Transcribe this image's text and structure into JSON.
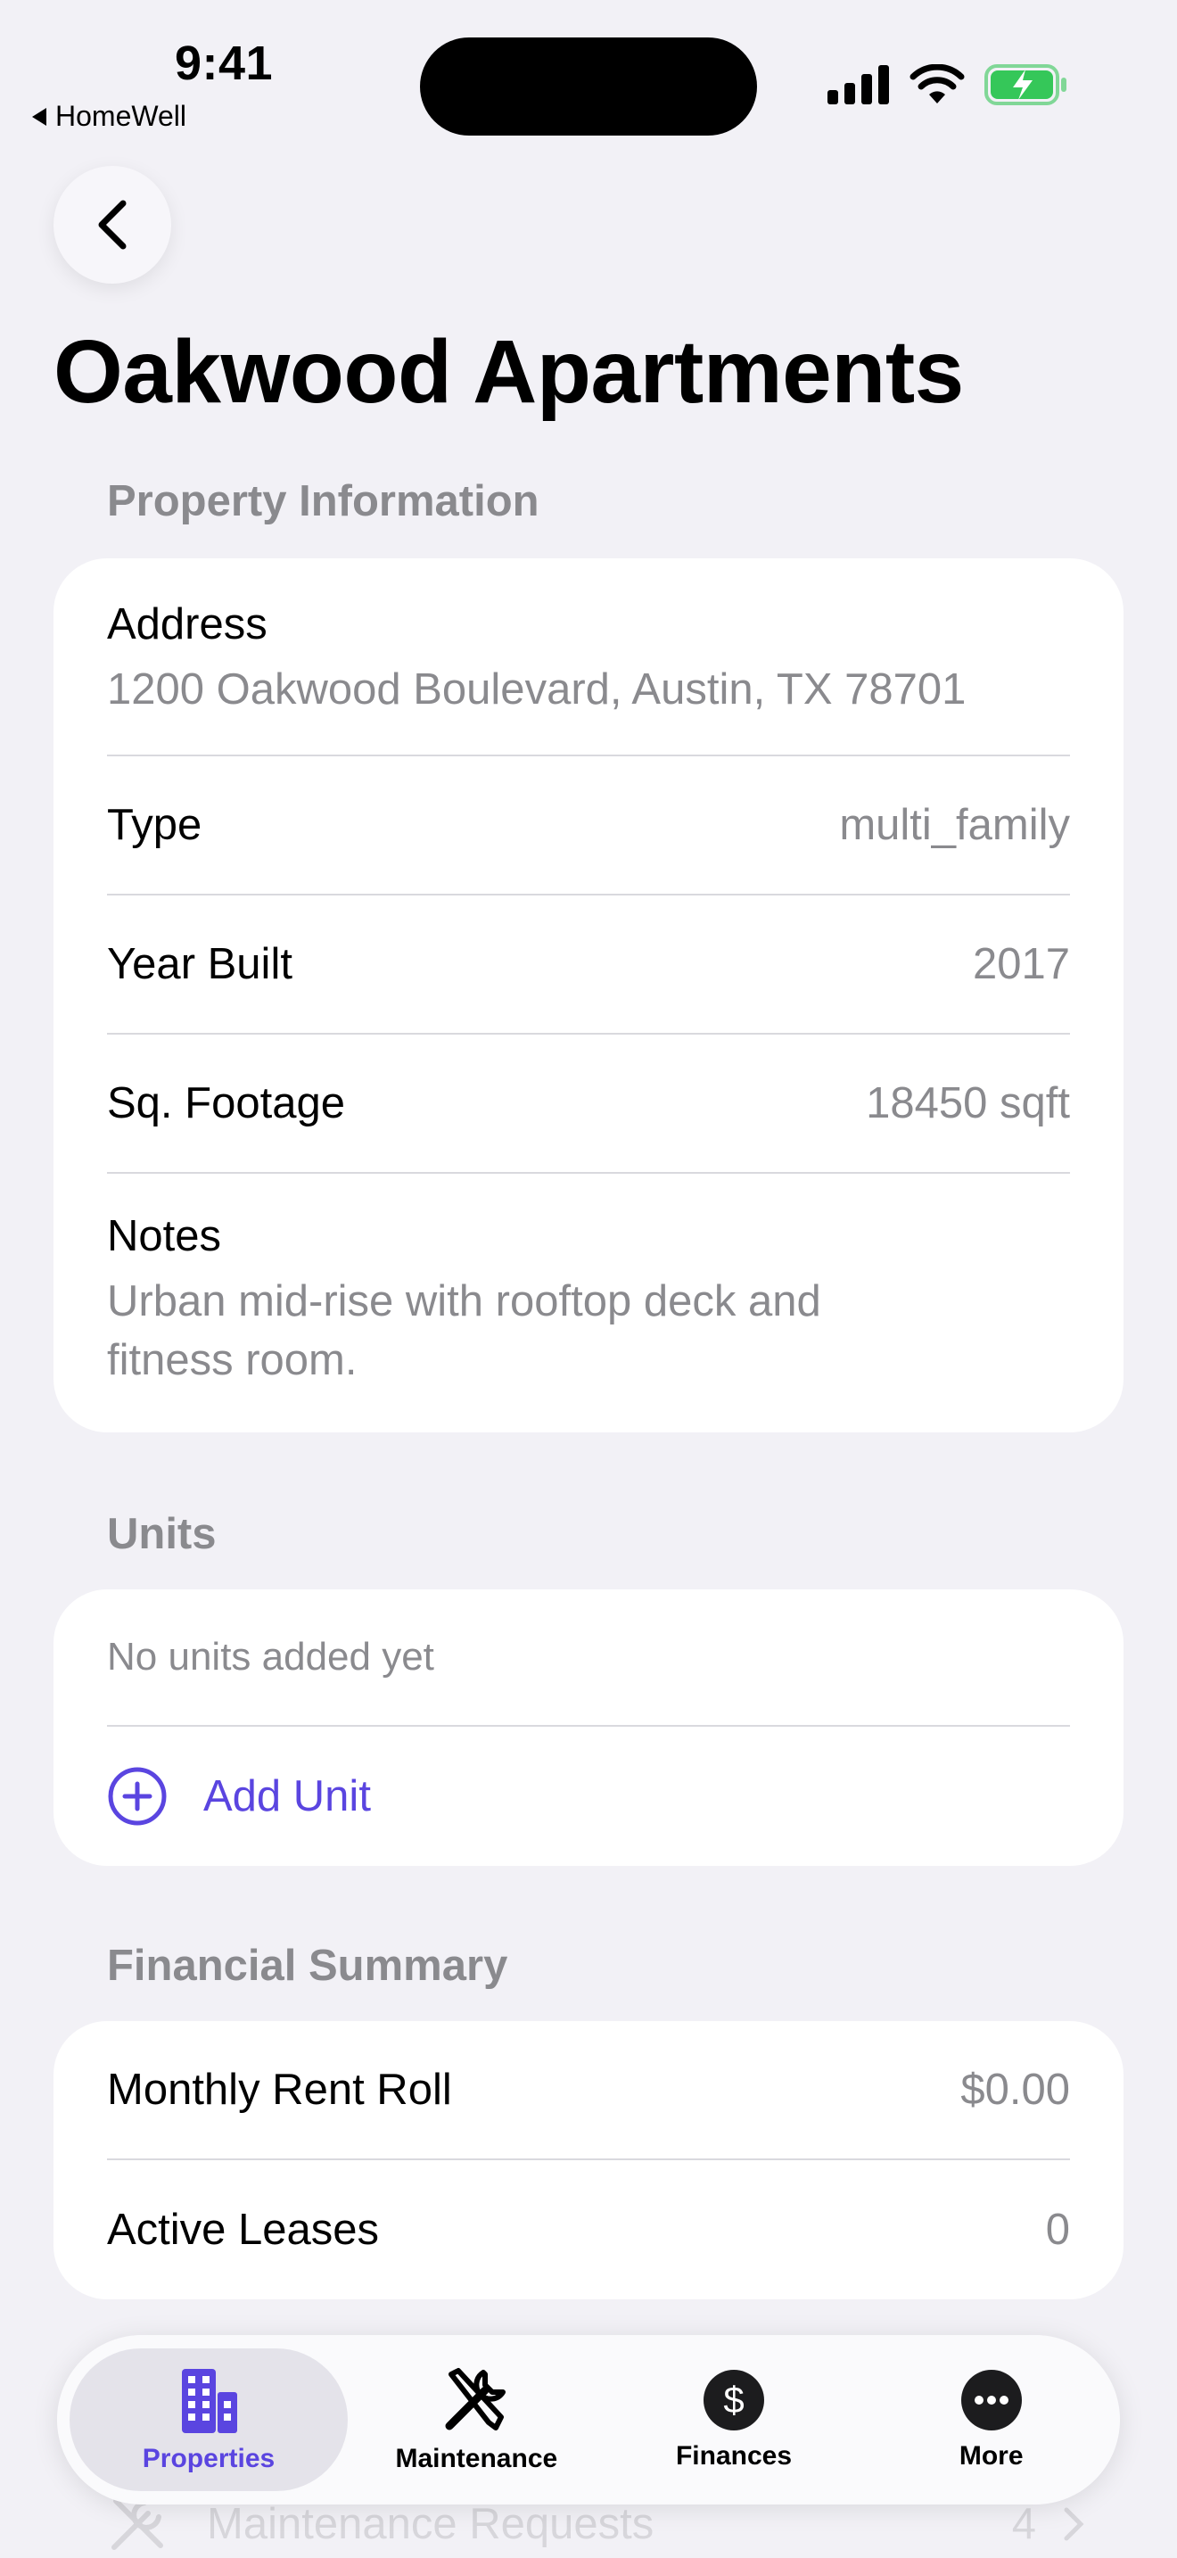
{
  "status_bar": {
    "time": "9:41",
    "back_app": "HomeWell"
  },
  "nav": {
    "back_icon": "chevron-left-icon"
  },
  "title": "Oakwood Apartments",
  "property_info": {
    "header": "Property Information",
    "address_label": "Address",
    "address_value": "1200 Oakwood Boulevard, Austin, TX 78701",
    "type_label": "Type",
    "type_value": "multi_family",
    "year_label": "Year Built",
    "year_value": "2017",
    "sqft_label": "Sq. Footage",
    "sqft_value": "18450 sqft",
    "notes_label": "Notes",
    "notes_value": "Urban mid-rise with rooftop deck and fitness room."
  },
  "units": {
    "header": "Units",
    "empty_text": "No units added yet",
    "add_label": "Add Unit"
  },
  "financial": {
    "header": "Financial Summary",
    "rent_label": "Monthly Rent Roll",
    "rent_value": "$0.00",
    "leases_label": "Active Leases",
    "leases_value": "0"
  },
  "behind_tabbar": {
    "label": "Maintenance Requests",
    "count": "4"
  },
  "tabs": [
    {
      "label": "Properties",
      "icon": "building-icon"
    },
    {
      "label": "Maintenance",
      "icon": "tools-icon"
    },
    {
      "label": "Finances",
      "icon": "dollar-circle-icon"
    },
    {
      "label": "More",
      "icon": "ellipsis-circle-icon"
    }
  ],
  "colors": {
    "accent": "#5a45e0",
    "background": "#f2f1f6",
    "secondary_text": "#8a8a8e",
    "battery": "#35c759"
  }
}
